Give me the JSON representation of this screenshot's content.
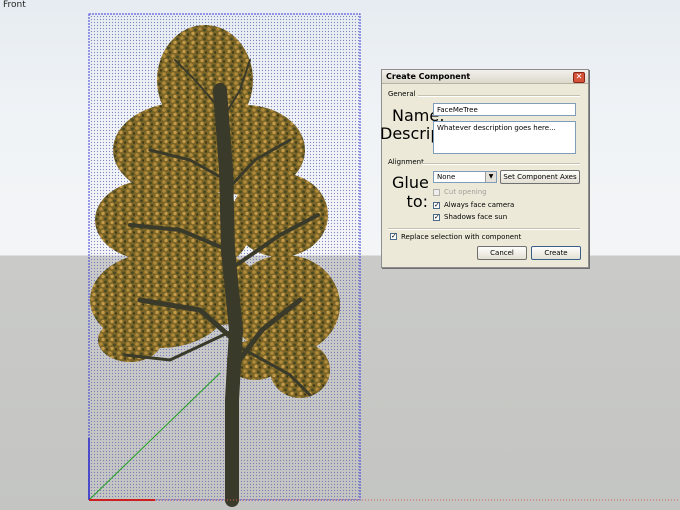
{
  "viewport": {
    "view_label": "Front",
    "background": {
      "sky": "#eef1f4",
      "ground": "#c8c8c6"
    },
    "axes": {
      "x_color": "#cc2020",
      "y_color": "#20a020",
      "z_color": "#2020cc"
    }
  },
  "dialog": {
    "title": "Create Component",
    "close_icon": "close-icon",
    "general": {
      "section_label": "General",
      "name_label": "Name:",
      "name_value": "FaceMeTree",
      "description_label": "Description:",
      "description_value": "Whatever description goes here..."
    },
    "alignment": {
      "section_label": "Alignment",
      "glue_label": "Glue to:",
      "glue_value": "None",
      "set_axes_label": "Set Component Axes",
      "cut_opening": {
        "label": "Cut opening",
        "checked": false,
        "enabled": false
      },
      "always_face_camera": {
        "label": "Always face camera",
        "checked": true,
        "enabled": true
      },
      "shadows_face_sun": {
        "label": "Shadows face sun",
        "checked": true,
        "enabled": true
      }
    },
    "replace_selection": {
      "label": "Replace selection with component",
      "checked": true
    },
    "buttons": {
      "cancel": "Cancel",
      "create": "Create"
    }
  }
}
